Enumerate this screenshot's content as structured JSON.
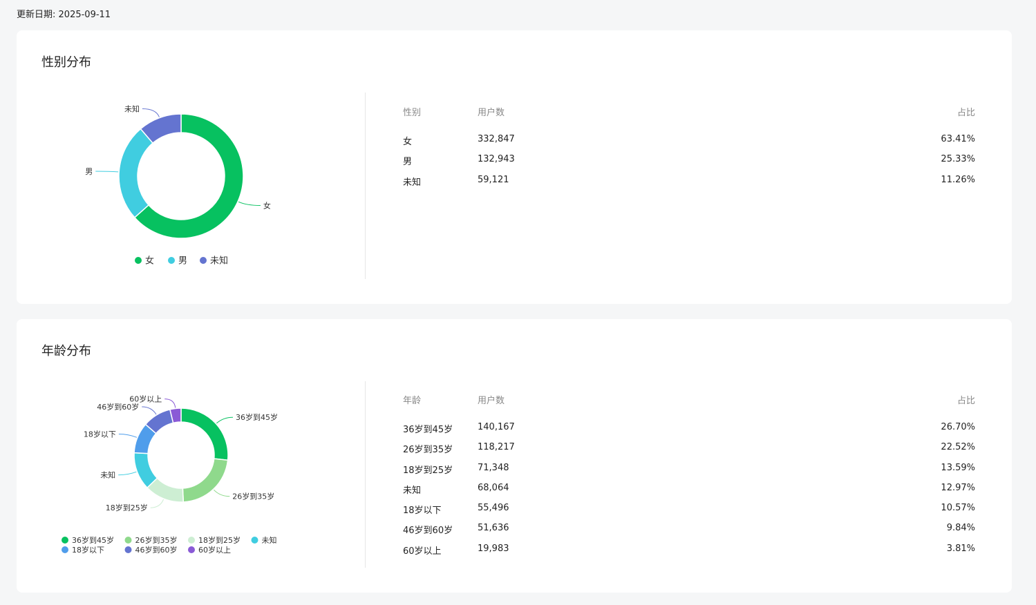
{
  "update": {
    "label": "更新日期:",
    "date": "2025-09-11"
  },
  "gender": {
    "title": "性别分布",
    "table": {
      "headers": [
        "性别",
        "用户数",
        "占比"
      ],
      "rows": [
        [
          "女",
          "332,847",
          "63.41%"
        ],
        [
          "男",
          "132,943",
          "25.33%"
        ],
        [
          "未知",
          "59,121",
          "11.26%"
        ]
      ]
    }
  },
  "age": {
    "title": "年龄分布",
    "table": {
      "headers": [
        "年龄",
        "用户数",
        "占比"
      ],
      "rows": [
        [
          "36岁到45岁",
          "140,167",
          "26.70%"
        ],
        [
          "26岁到35岁",
          "118,217",
          "22.52%"
        ],
        [
          "18岁到25岁",
          "71,348",
          "13.59%"
        ],
        [
          "未知",
          "68,064",
          "12.97%"
        ],
        [
          "18岁以下",
          "55,496",
          "10.57%"
        ],
        [
          "46岁到60岁",
          "51,636",
          "9.84%"
        ],
        [
          "60岁以上",
          "19,983",
          "3.81%"
        ]
      ]
    }
  },
  "chart_data": [
    {
      "type": "pie",
      "categories": [
        "女",
        "男",
        "未知"
      ],
      "values": [
        332847,
        132943,
        59121
      ],
      "colors": [
        "#07c160",
        "#40cde0",
        "#6474d0"
      ],
      "legend_position": "bottom"
    },
    {
      "type": "pie",
      "categories": [
        "36岁到45岁",
        "26岁到35岁",
        "18岁到25岁",
        "未知",
        "18岁以下",
        "46岁到60岁",
        "60岁以上"
      ],
      "values": [
        140167,
        118217,
        71348,
        68064,
        55496,
        51636,
        19983
      ],
      "colors": [
        "#07c160",
        "#8fd98c",
        "#cdeed3",
        "#40cde0",
        "#4f9deb",
        "#6474d0",
        "#8a5ad6"
      ],
      "legend_position": "bottom"
    }
  ]
}
